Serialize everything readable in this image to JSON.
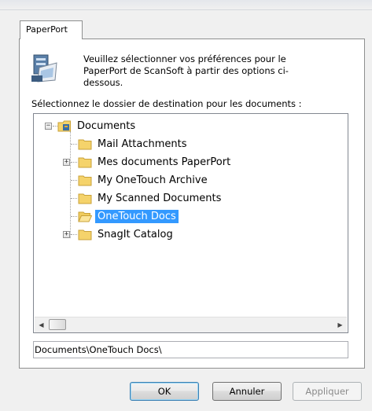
{
  "tab": {
    "label": "PaperPort"
  },
  "intro_text": "Veuillez sélectionner vos préférences pour le PaperPort de ScanSoft à partir des options ci-dessous.",
  "tree_label": "Sélectionnez le dossier de destination pour les documents :",
  "tree": {
    "root": {
      "label": "Documents",
      "icon": "documents-folder-icon"
    },
    "items": [
      {
        "label": "Mail Attachments",
        "expandable": false,
        "selected": false,
        "icon": "folder-icon"
      },
      {
        "label": "Mes documents PaperPort",
        "expandable": true,
        "selected": false,
        "icon": "folder-icon"
      },
      {
        "label": "My OneTouch Archive",
        "expandable": false,
        "selected": false,
        "icon": "folder-icon"
      },
      {
        "label": "My Scanned Documents",
        "expandable": false,
        "selected": false,
        "icon": "folder-icon"
      },
      {
        "label": "OneTouch Docs",
        "expandable": false,
        "selected": true,
        "icon": "folder-open-icon"
      },
      {
        "label": "SnagIt Catalog",
        "expandable": true,
        "selected": false,
        "icon": "folder-icon"
      }
    ]
  },
  "path_value": "Documents\\OneTouch Docs\\",
  "buttons": {
    "ok": "OK",
    "cancel": "Annuler",
    "apply": "Appliquer"
  },
  "colors": {
    "selection": "#3399ff",
    "folder": "#f5d36b"
  }
}
